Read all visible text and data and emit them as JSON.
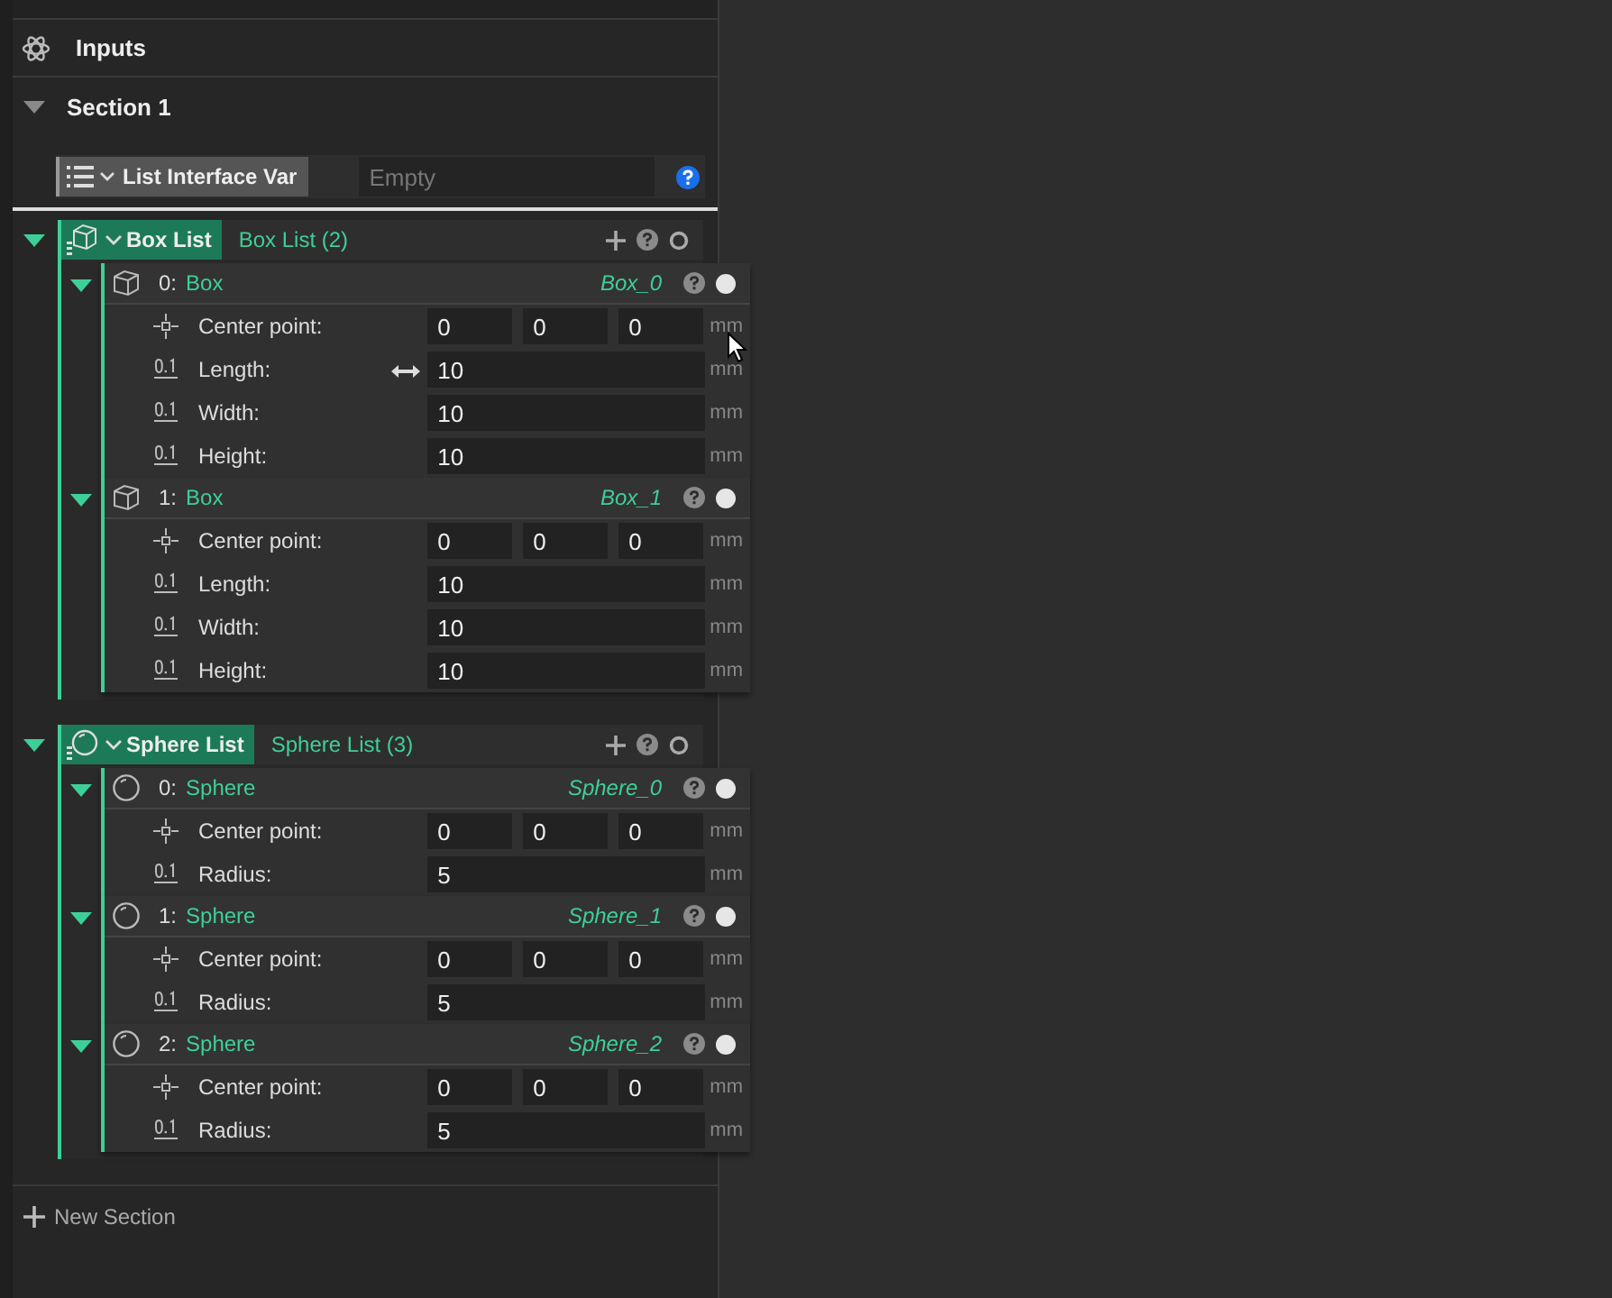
{
  "panel": {
    "title": "Inputs"
  },
  "section": {
    "title": "Section 1",
    "expanded": true
  },
  "interface_var": {
    "label": "List Interface Var",
    "placeholder": "Empty"
  },
  "lists": [
    {
      "kind": "box",
      "label": "Box List",
      "name": "Box List (2)",
      "expanded": true,
      "items": [
        {
          "index": "0:",
          "type": "Box",
          "name": "Box_0",
          "expanded": true,
          "params": [
            {
              "kind": "point",
              "label": "Center point:",
              "values": [
                "0",
                "0",
                "0"
              ],
              "unit": "mm"
            },
            {
              "kind": "number",
              "label": "Length:",
              "value": "10",
              "unit": "mm"
            },
            {
              "kind": "number",
              "label": "Width:",
              "value": "10",
              "unit": "mm"
            },
            {
              "kind": "number",
              "label": "Height:",
              "value": "10",
              "unit": "mm"
            }
          ]
        },
        {
          "index": "1:",
          "type": "Box",
          "name": "Box_1",
          "expanded": true,
          "params": [
            {
              "kind": "point",
              "label": "Center point:",
              "values": [
                "0",
                "0",
                "0"
              ],
              "unit": "mm"
            },
            {
              "kind": "number",
              "label": "Length:",
              "value": "10",
              "unit": "mm"
            },
            {
              "kind": "number",
              "label": "Width:",
              "value": "10",
              "unit": "mm"
            },
            {
              "kind": "number",
              "label": "Height:",
              "value": "10",
              "unit": "mm"
            }
          ]
        }
      ]
    },
    {
      "kind": "sphere",
      "label": "Sphere List",
      "name": "Sphere List (3)",
      "expanded": true,
      "items": [
        {
          "index": "0:",
          "type": "Sphere",
          "name": "Sphere_0",
          "expanded": true,
          "params": [
            {
              "kind": "point",
              "label": "Center point:",
              "values": [
                "0",
                "0",
                "0"
              ],
              "unit": "mm"
            },
            {
              "kind": "number",
              "label": "Radius:",
              "value": "5",
              "unit": "mm"
            }
          ]
        },
        {
          "index": "1:",
          "type": "Sphere",
          "name": "Sphere_1",
          "expanded": true,
          "params": [
            {
              "kind": "point",
              "label": "Center point:",
              "values": [
                "0",
                "0",
                "0"
              ],
              "unit": "mm"
            },
            {
              "kind": "number",
              "label": "Radius:",
              "value": "5",
              "unit": "mm"
            }
          ]
        },
        {
          "index": "2:",
          "type": "Sphere",
          "name": "Sphere_2",
          "expanded": true,
          "params": [
            {
              "kind": "point",
              "label": "Center point:",
              "values": [
                "0",
                "0",
                "0"
              ],
              "unit": "mm"
            },
            {
              "kind": "number",
              "label": "Radius:",
              "value": "5",
              "unit": "mm"
            }
          ]
        }
      ]
    }
  ],
  "new_section": "New Section"
}
